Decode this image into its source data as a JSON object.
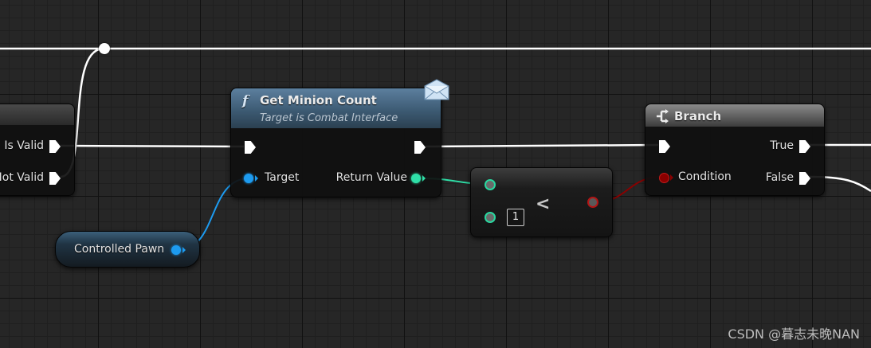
{
  "nodes": {
    "is_valid": {
      "outputs": [
        "Is Valid",
        "Not Valid"
      ]
    },
    "get_minion_count": {
      "title": "Get Minion Count",
      "subtitle": "Target is Combat Interface",
      "function_glyph": "f",
      "input": "Target",
      "output": "Return Value",
      "badge_icon": "message-envelope-icon"
    },
    "compare": {
      "operator": "<",
      "literal_value": "1"
    },
    "branch": {
      "title": "Branch",
      "icon": "branch-icon",
      "input": "Condition",
      "outputs": [
        "True",
        "False"
      ]
    },
    "variable": {
      "label": "Controlled Pawn"
    }
  },
  "colors": {
    "exec_wire": "#ffffff",
    "object_pin": "#1d9bf0",
    "integer_pin": "#2fe0a8",
    "boolean_pin": "#8a0000"
  },
  "watermark": "CSDN @暮志未晚NAN"
}
